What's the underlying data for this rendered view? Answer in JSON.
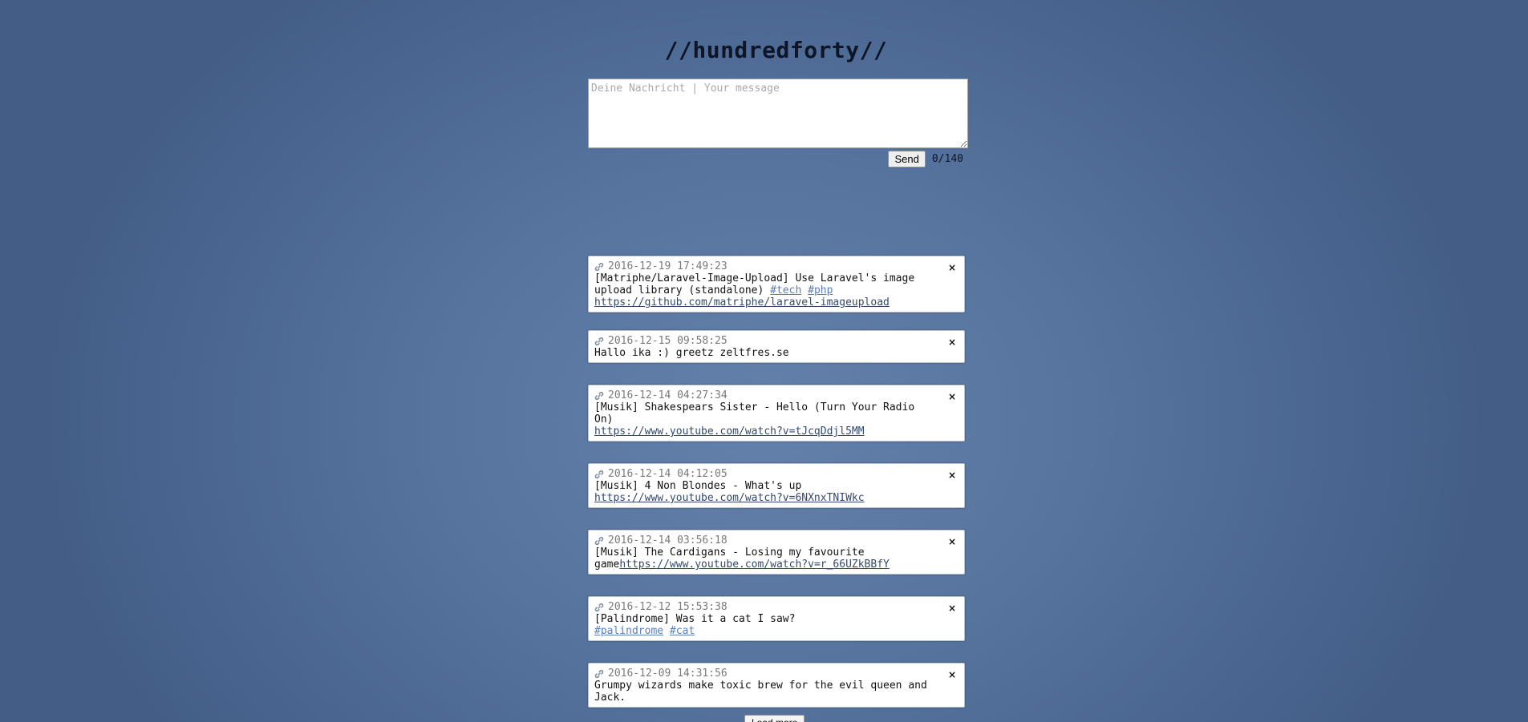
{
  "header": {
    "title": "//hundredforty//"
  },
  "composer": {
    "placeholder": "Deine Nachricht | Your message",
    "value": "",
    "send_label": "Send",
    "counter": "0/140"
  },
  "posts": [
    {
      "timestamp": "2016-12-19 17:49:23",
      "parts": [
        {
          "t": "text",
          "v": "[Matriphe/Laravel-Image-Upload] Use Laravel's image upload library (standalone) "
        },
        {
          "t": "tag",
          "v": "#tech"
        },
        {
          "t": "text",
          "v": " "
        },
        {
          "t": "tag",
          "v": "#php"
        },
        {
          "t": "br"
        },
        {
          "t": "url",
          "v": "https://github.com/matriphe/laravel-imageupload"
        }
      ]
    },
    {
      "timestamp": "2016-12-15 09:58:25",
      "parts": [
        {
          "t": "text",
          "v": "Hallo ika :) greetz zeltfres.se"
        }
      ]
    },
    {
      "timestamp": "2016-12-14 04:27:34",
      "parts": [
        {
          "t": "text",
          "v": "[Musik] Shakespears Sister - Hello (Turn Your Radio On)"
        },
        {
          "t": "br"
        },
        {
          "t": "url",
          "v": "https://www.youtube.com/watch?v=tJcqDdjl5MM"
        }
      ]
    },
    {
      "timestamp": "2016-12-14 04:12:05",
      "parts": [
        {
          "t": "text",
          "v": "[Musik] 4 Non Blondes - What's up"
        },
        {
          "t": "br"
        },
        {
          "t": "url",
          "v": "https://www.youtube.com/watch?v=6NXnxTNIWkc"
        }
      ]
    },
    {
      "timestamp": "2016-12-14 03:56:18",
      "parts": [
        {
          "t": "text",
          "v": "[Musik] The Cardigans - Losing my favourite game"
        },
        {
          "t": "url",
          "v": "https://www.youtube.com/watch?v=r_66UZkBBfY"
        }
      ]
    },
    {
      "timestamp": "2016-12-12 15:53:38",
      "parts": [
        {
          "t": "text",
          "v": "[Palindrome] Was it a cat I saw?"
        },
        {
          "t": "br"
        },
        {
          "t": "tag",
          "v": "#palindrome"
        },
        {
          "t": "text",
          "v": " "
        },
        {
          "t": "tag",
          "v": "#cat"
        }
      ]
    },
    {
      "timestamp": "2016-12-09 14:31:56",
      "parts": [
        {
          "t": "text",
          "v": "Grumpy wizards make toxic brew for the evil queen and Jack."
        }
      ]
    }
  ],
  "icons": {
    "post_link": "link-icon",
    "post_delete": "close-icon"
  },
  "close_glyph": "×",
  "load_more_label": "Load more",
  "colors": {
    "tag": "#5a7fbb",
    "url": "#33496b",
    "timestamp": "#7a7a7a"
  }
}
